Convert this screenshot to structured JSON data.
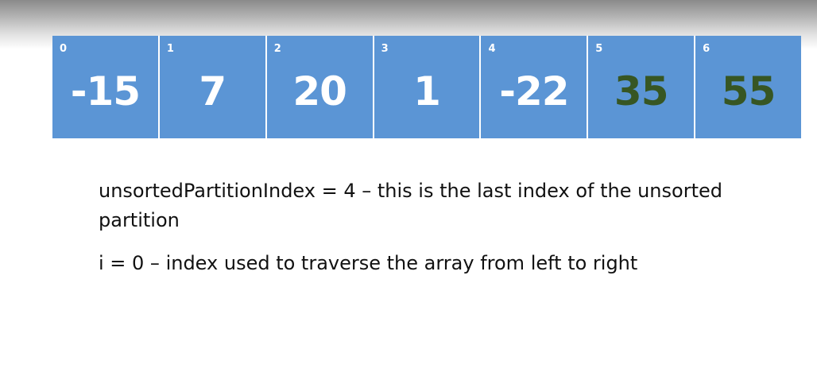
{
  "array": {
    "cells": [
      {
        "index": "0",
        "value": "-15",
        "sorted": false
      },
      {
        "index": "1",
        "value": "7",
        "sorted": false
      },
      {
        "index": "2",
        "value": "20",
        "sorted": false
      },
      {
        "index": "3",
        "value": "1",
        "sorted": false
      },
      {
        "index": "4",
        "value": "-22",
        "sorted": false
      },
      {
        "index": "5",
        "value": "35",
        "sorted": true
      },
      {
        "index": "6",
        "value": "55",
        "sorted": true
      }
    ],
    "unsorted_color": "#ffffff",
    "sorted_color": "#375623",
    "cell_color": "#5b95d5"
  },
  "notes": {
    "line1": "unsortedPartitionIndex = 4 – this is the last index of the unsorted partition",
    "line2": "i = 0 – index used to traverse the array from left to right"
  }
}
